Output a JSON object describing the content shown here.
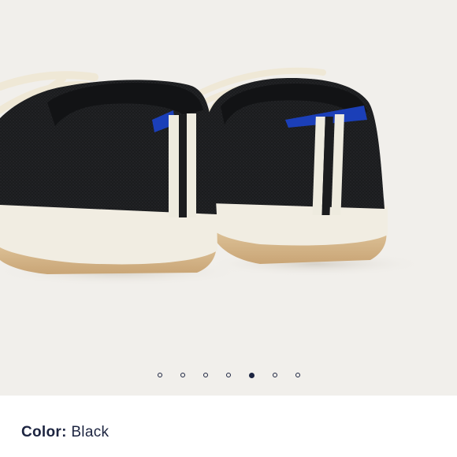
{
  "product": {
    "image": {
      "alt_icon": "black-knit-sneakers-photo",
      "colors": {
        "background": "#f1efeb",
        "knit": "#1b1c1e",
        "sole": "#f1ede2",
        "gum": "#d8b98a",
        "stripe": "#eeebdf",
        "tab": "#1b3fb8"
      }
    },
    "carousel": {
      "total": 7,
      "active_index": 4,
      "dot_color": "#1c2440"
    },
    "color": {
      "label": "Color:",
      "value": "Black"
    }
  }
}
